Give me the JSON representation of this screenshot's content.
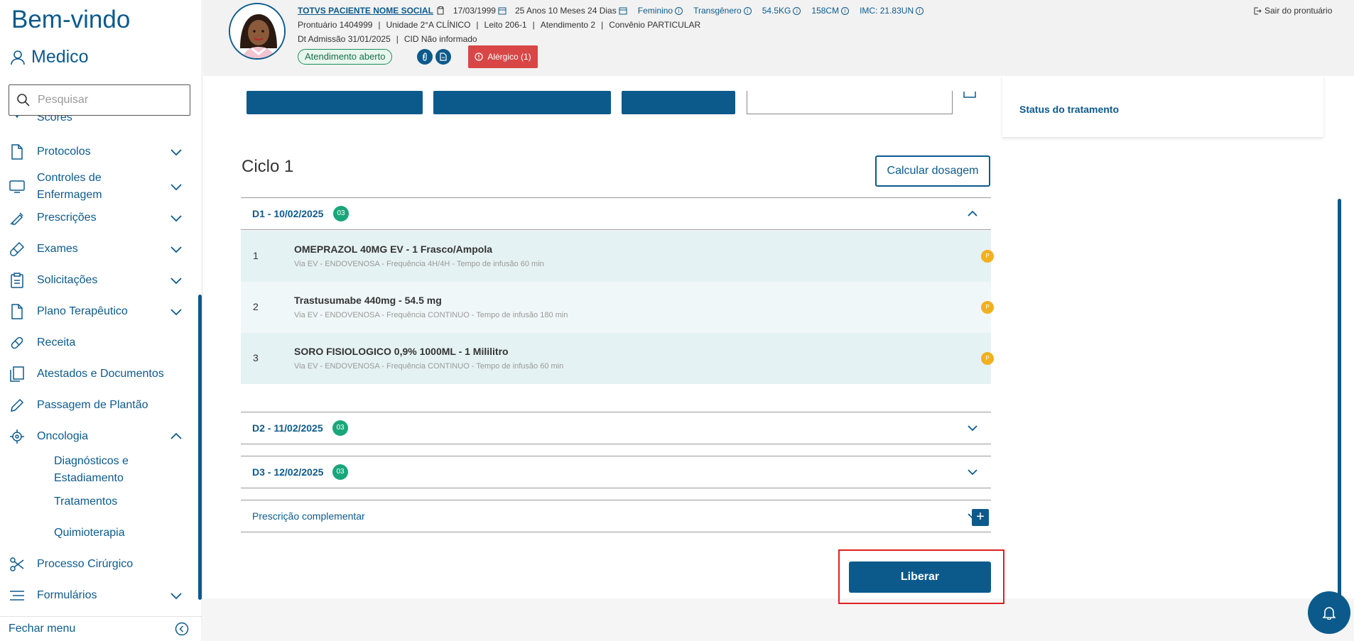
{
  "sidebar": {
    "welcome": "Bem-vindo",
    "user": "Medico",
    "search_placeholder": "Pesquisar",
    "items": [
      {
        "label": "Scores"
      },
      {
        "label": "Protocolos"
      },
      {
        "label": "Controles de Enfermagem"
      },
      {
        "label": "Prescrições"
      },
      {
        "label": "Exames"
      },
      {
        "label": "Solicitações"
      },
      {
        "label": "Plano Terapêutico"
      },
      {
        "label": "Receita"
      },
      {
        "label": "Atestados e Documentos"
      },
      {
        "label": "Passagem de Plantão"
      },
      {
        "label": "Oncologia"
      },
      {
        "label": "Processo Cirúrgico"
      },
      {
        "label": "Formulários"
      }
    ],
    "oncologia_sub": [
      "Diagnósticos e Estadiamento",
      "Tratamentos",
      "Quimioterapia"
    ],
    "footer": "Fechar menu"
  },
  "patient": {
    "name": "TOTVS PACIENTE NOME SOCIAL",
    "birth": "17/03/1999",
    "age": "25 Anos 10 Meses 24 Dias",
    "sex": "Feminino",
    "gender": "Transgênero",
    "weight": "54.5KG",
    "height": "158CM",
    "imc": "IMC: 21.83UN",
    "prontuario": "Prontuário 1404999",
    "unidade": "Unidade 2°A CLÍNICO",
    "leito": "Leito 206-1",
    "atendimento": "Atendimento 2",
    "convenio": "Convênio PARTICULAR",
    "admissao": "Dt Admissão 31/01/2025",
    "cid": "CID Não informado",
    "status": "Atendimento aberto",
    "alergico": "Alérgico (1)",
    "exit": "Sair do prontuário"
  },
  "treatment": {
    "status_title": "Status do tratamento",
    "ciclo": "Ciclo 1",
    "calc_button": "Calcular dosagem",
    "days": [
      {
        "title": "D1 - 10/02/2025",
        "count": "03"
      },
      {
        "title": "D2 - 11/02/2025",
        "count": "03"
      },
      {
        "title": "D3 - 12/02/2025",
        "count": "03"
      }
    ],
    "meds": [
      {
        "num": "1",
        "name": "OMEPRAZOL 40MG EV - 1 Frasco/Ampola",
        "detail": "Via EV - ENDOVENOSA - Frequência 4H/4H - Tempo de infusão 60 min",
        "badge": "P"
      },
      {
        "num": "2",
        "name": "Trastusumabe 440mg - 54.5 mg",
        "detail": "Via EV - ENDOVENOSA - Frequência CONTINUO - Tempo de infusão 180 min",
        "badge": "P"
      },
      {
        "num": "3",
        "name": "SORO FISIOLOGICO 0,9% 1000ML - 1 Mililitro",
        "detail": "Via EV - ENDOVENOSA - Frequência CONTINUO - Tempo de infusão 60 min",
        "badge": "P"
      }
    ],
    "complementar": "Prescrição complementar",
    "liberar": "Liberar"
  }
}
